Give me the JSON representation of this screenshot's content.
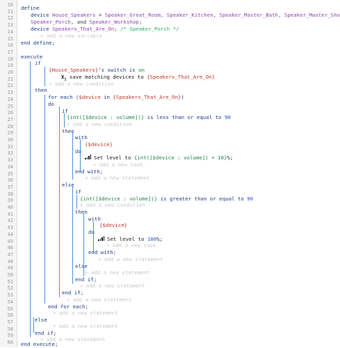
{
  "line_numbers": [
    "10",
    "11",
    "12",
    "13",
    "14",
    "15",
    "16",
    "17",
    "18",
    "19",
    "20",
    "21",
    "22",
    "23",
    "24",
    "25",
    "26",
    "27",
    "28",
    "29",
    "30",
    "31",
    "32",
    "33",
    "34",
    "35",
    "36",
    "37",
    "38",
    "39",
    "40",
    "41",
    "42",
    "43",
    "44",
    "45",
    "46",
    "47",
    "48",
    "49",
    "50",
    "51",
    "52",
    "53",
    "54",
    "55",
    "56",
    "57",
    "58",
    "59",
    "60"
  ],
  "define": {
    "kw_define": "define",
    "device_kw": "device",
    "house_speakers": "House_Speakers",
    "equals": " = ",
    "list_line1": "Speaker_Great_Room, Speaker_Kitchen, Speaker_Master_Bath, Speaker_Master_Shower,",
    "list_line2a": "Speaker_Porch",
    "list_line2b": ", and ",
    "list_line2c": "Speaker_Workshop",
    "semi": ";",
    "device_kw2": "device",
    "speakers_on": "Speakers_That_Are_On",
    "cmt": "/* Speaker_Porch */",
    "add_variable": "+ add a new variable",
    "end_define": "end define;"
  },
  "execute": {
    "kw_execute": "execute",
    "if": "if",
    "cond1_var": "{House_Speakers}",
    "cond1_text": "'s switch is ",
    "cond1_val": "on",
    "save_text": "save matching devices to ",
    "save_var": "{Speakers_That_Are_On}",
    "add_condition": "+ add a new condition",
    "then": "then",
    "for_each": "for each (",
    "for_var": "$device",
    "for_in": " in ",
    "for_list": "{Speakers_That_Are_On}",
    "for_close": ")",
    "do": "do",
    "if2": "if",
    "cond2_expr": "{int([$device : volume])}",
    "cond2_text": " is less than or equal to ",
    "cond2_val": "90",
    "then2": "then",
    "with": "with",
    "device_ref": "{$device}",
    "do2": "do",
    "set_level_text": "Set level to ",
    "set_level_expr": "{int([$device : volume]) + 10}",
    "set_level_pct": "%;",
    "add_task": "+ add a new task",
    "end_with": "end with;",
    "add_statement": "+ add a new statement",
    "else": "else",
    "if3": "if",
    "cond3_expr": "{int([$device : volume])}",
    "cond3_text": " is greater than or equal to ",
    "cond3_val": "90",
    "then3": "then",
    "with3": "with",
    "device_ref3": "{$device}",
    "do3": "do",
    "set_level_text3": "Set level to ",
    "set_level_val3": "100",
    "set_level_pct3": "%;",
    "end_if": "end if;",
    "end_for_each": "end for each;",
    "end_execute": "end execute;"
  },
  "icons": {
    "save_icon": "x-sub-one",
    "level_icon": "signal-bars"
  }
}
